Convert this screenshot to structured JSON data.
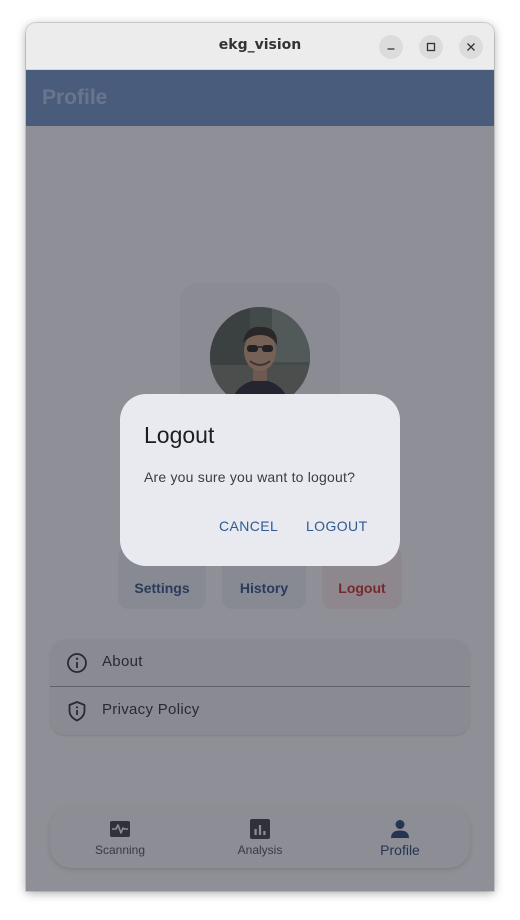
{
  "window": {
    "title": "ekg_vision"
  },
  "appbar": {
    "title": "Profile"
  },
  "profile": {
    "avatar_icon": "user-photo"
  },
  "tiles": [
    {
      "label": "Settings",
      "icon": "gear-icon"
    },
    {
      "label": "History",
      "icon": "history-icon"
    },
    {
      "label": "Logout",
      "icon": "logout-icon"
    }
  ],
  "menu": [
    {
      "label": "About",
      "icon": "info-icon"
    },
    {
      "label": "Privacy Policy",
      "icon": "shield-icon"
    }
  ],
  "bottom_nav": [
    {
      "label": "Scanning",
      "icon": "pulse-icon"
    },
    {
      "label": "Analysis",
      "icon": "bar-chart-icon"
    },
    {
      "label": "Profile",
      "icon": "person-icon",
      "active": true
    }
  ],
  "dialog": {
    "title": "Logout",
    "message": "Are you sure you want to logout?",
    "cancel_label": "CANCEL",
    "confirm_label": "LOGOUT"
  },
  "colors": {
    "primary": "#6d90c4",
    "accent_text": "#2f5a92",
    "danger": "#c62828"
  }
}
